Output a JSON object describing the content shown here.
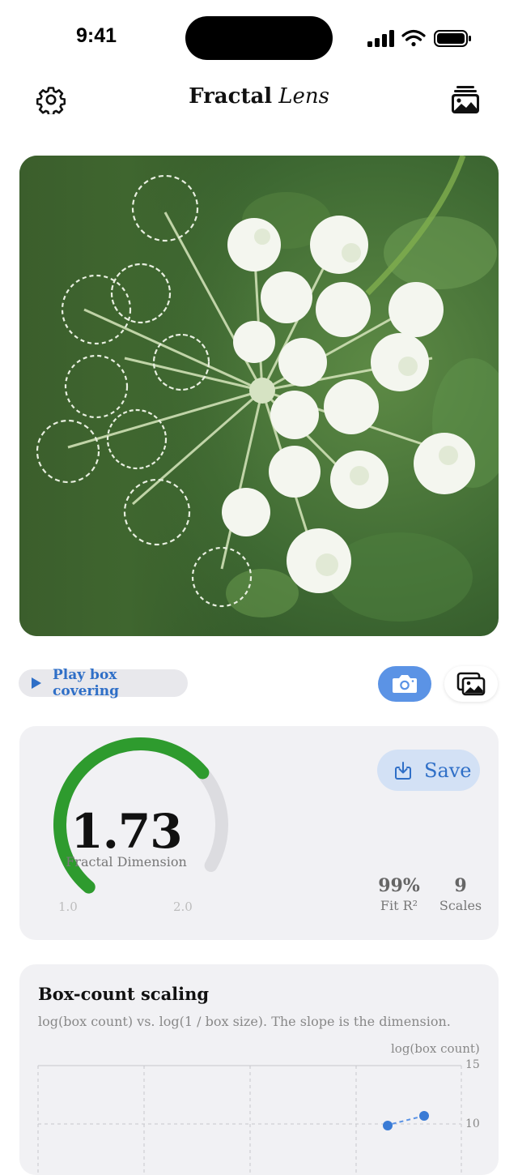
{
  "status": {
    "time": "9:41"
  },
  "header": {
    "title_bold": "Fractal",
    "title_italic": "Lens",
    "settings_icon": "gear-icon",
    "gallery_icon": "photo-stack-icon"
  },
  "photo": {
    "subject": "Queen Anne's lace flower with edge-detected outline overlay"
  },
  "controls": {
    "play_label": "Play box covering",
    "camera_icon": "camera-icon",
    "gallery_icon": "gallery-icon",
    "accent": "#2f6fc7"
  },
  "dimension": {
    "value": "1.73",
    "label": "Fractal Dimension",
    "min_label": "1.0",
    "max_label": "2.0",
    "gauge_fraction": 0.73,
    "gauge_color": "#2e9b2e",
    "save_label": "Save",
    "fit_value": "99%",
    "fit_label": "Fit R²",
    "scales_value": "9",
    "scales_label": "Scales"
  },
  "scaling": {
    "title": "Box-count scaling",
    "subtitle": "log(box count) vs. log(1 / box size). The slope is the dimension.",
    "y_axis_label": "log(box count)",
    "y_tick_top": "15",
    "y_tick_next": "10"
  },
  "chart_data": {
    "type": "scatter",
    "ylabel": "log(box count)",
    "y_ticks": [
      "15",
      "10"
    ],
    "x": [],
    "y": []
  }
}
